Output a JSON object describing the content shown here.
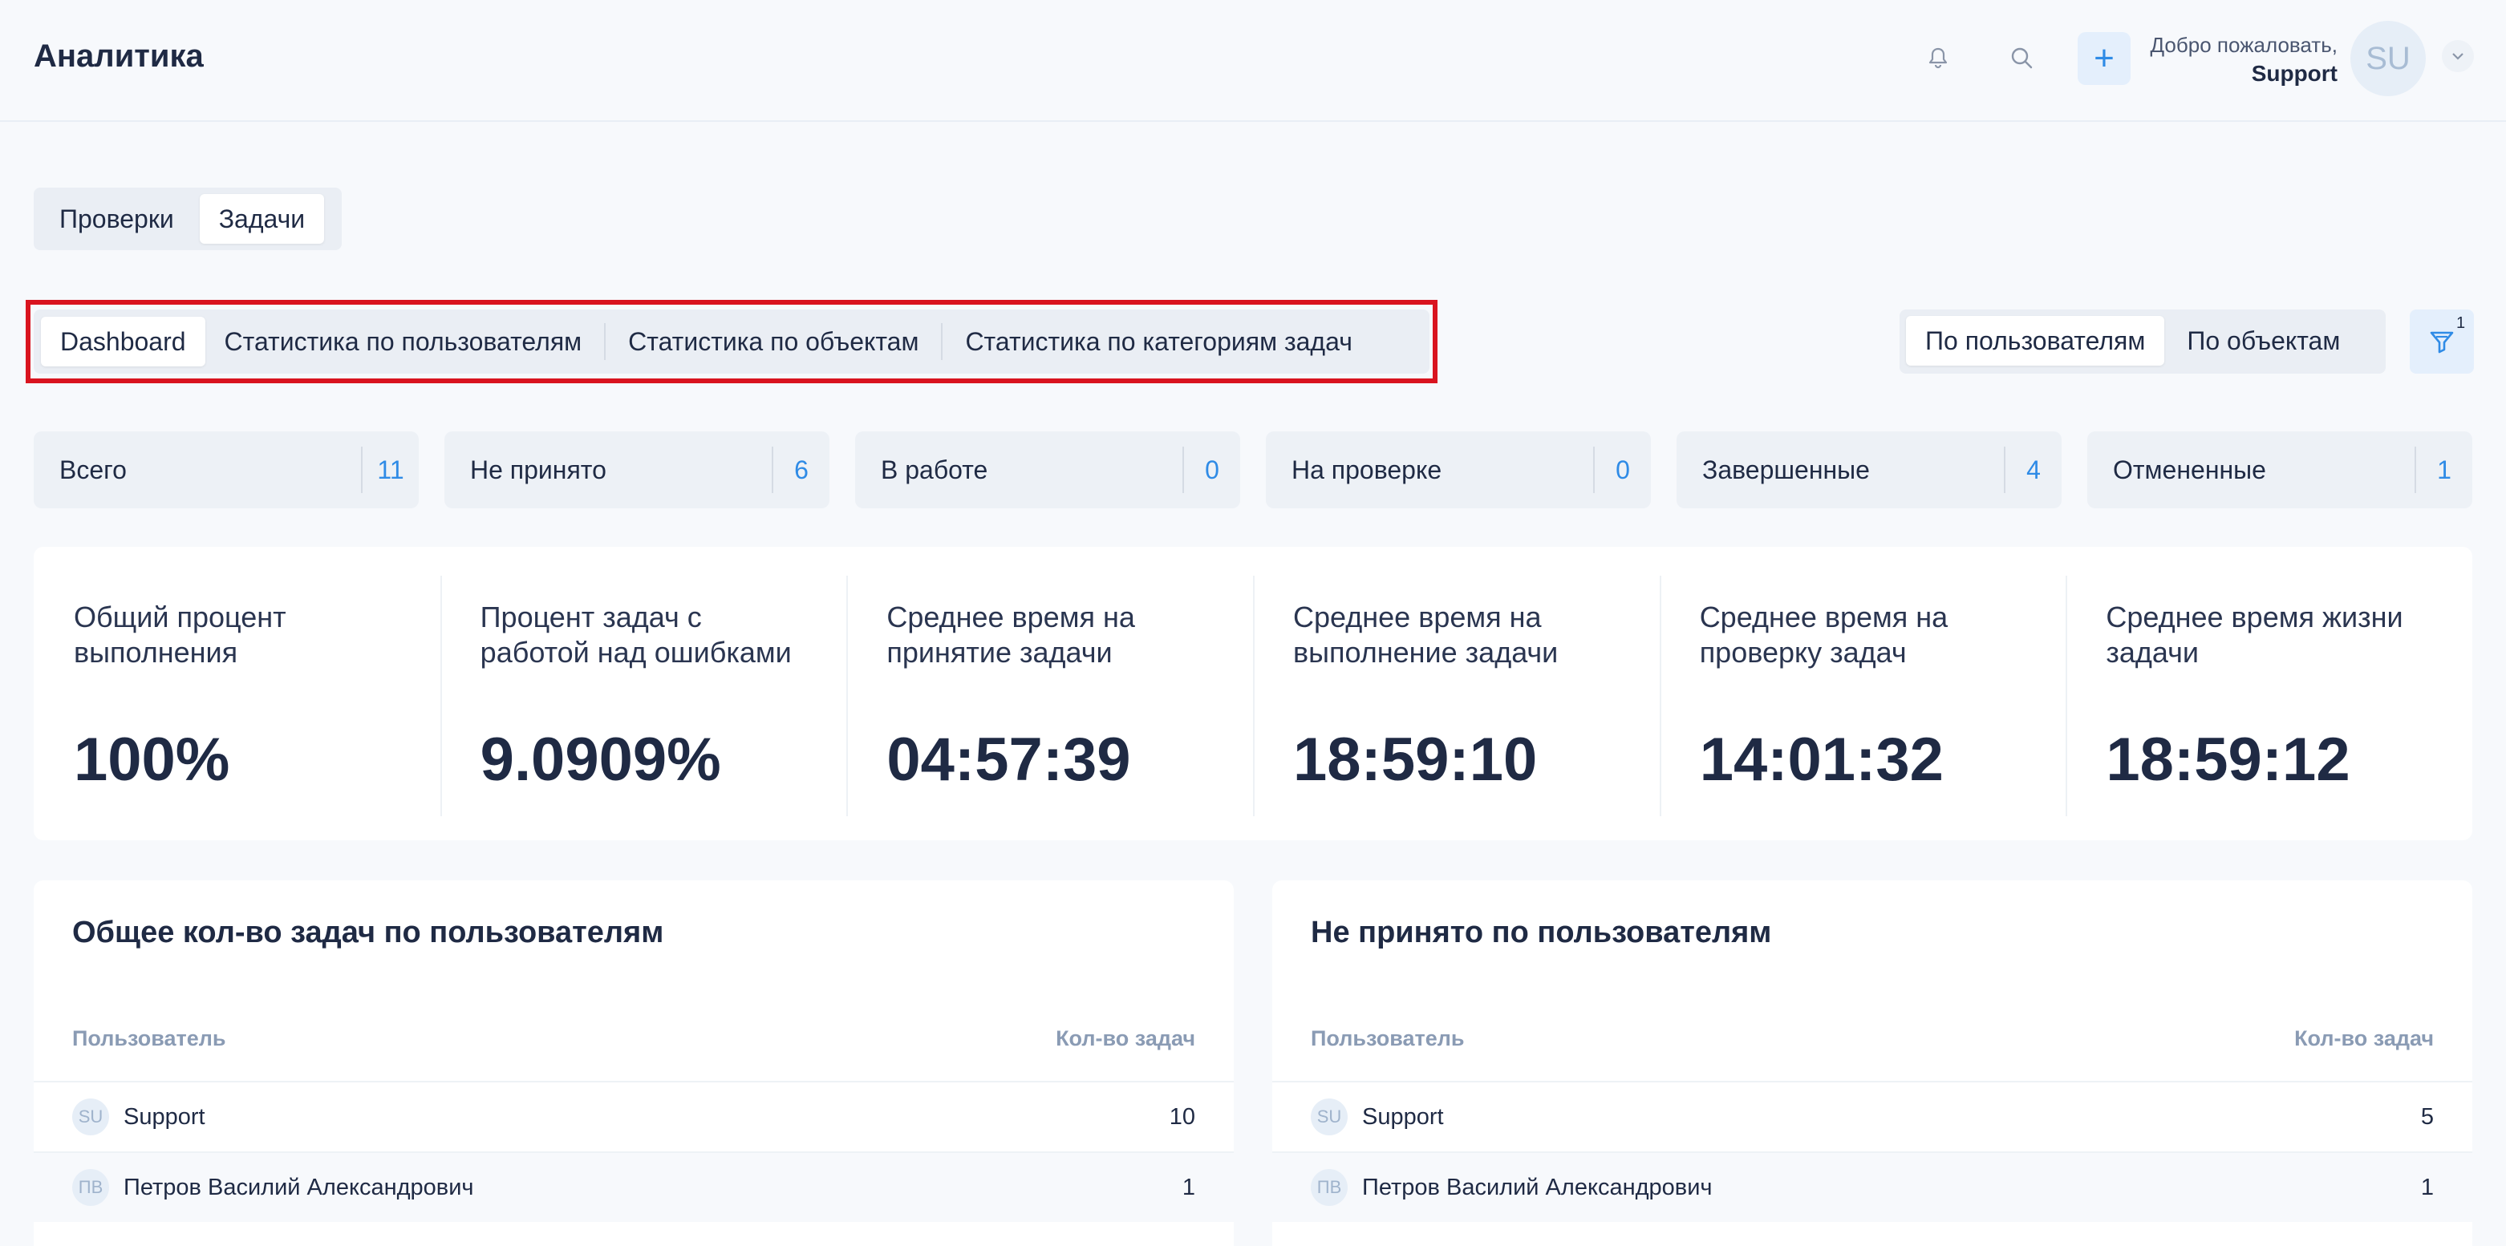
{
  "header": {
    "title": "Аналитика",
    "welcome": "Добро пожаловать,",
    "user_name": "Support",
    "avatar": "SU",
    "plus_label": "+",
    "icons": [
      "bell-icon",
      "search-icon",
      "plus-icon",
      "chevron-down-icon"
    ]
  },
  "top_tabs": [
    {
      "label": "Проверки",
      "active": false
    },
    {
      "label": "Задачи",
      "active": true
    }
  ],
  "sub_tabs": [
    {
      "label": "Dashboard",
      "active": true
    },
    {
      "label": "Статистика по пользователям",
      "active": false
    },
    {
      "label": "Статистика по объектам",
      "active": false
    },
    {
      "label": "Статистика по категориям задач",
      "active": false
    }
  ],
  "view_toggle": [
    {
      "label": "По пользователям",
      "active": true
    },
    {
      "label": "По объектам",
      "active": false
    }
  ],
  "filter": {
    "badge": "1"
  },
  "status_cards": [
    {
      "label": "Всего",
      "value": "11"
    },
    {
      "label": "Не принято",
      "value": "6"
    },
    {
      "label": "В работе",
      "value": "0"
    },
    {
      "label": "На проверке",
      "value": "0"
    },
    {
      "label": "Завершенные",
      "value": "4"
    },
    {
      "label": "Отмененные",
      "value": "1"
    }
  ],
  "metrics": [
    {
      "label": "Общий процент выполнения",
      "value": "100%"
    },
    {
      "label": "Процент задач с работой над ошибками",
      "value": "9.0909%"
    },
    {
      "label": "Среднее время на принятие задачи",
      "value": "04:57:39"
    },
    {
      "label": "Среднее время на выполнение задачи",
      "value": "18:59:10"
    },
    {
      "label": "Среднее время на проверку задач",
      "value": "14:01:32"
    },
    {
      "label": "Среднее время жизни задачи",
      "value": "18:59:12"
    }
  ],
  "tables": [
    {
      "title": "Общее кол-во задач по пользователям",
      "col_user": "Пользователь",
      "col_count": "Кол-во задач",
      "rows": [
        {
          "initials": "SU",
          "name": "Support",
          "count": "10"
        },
        {
          "initials": "ПВ",
          "name": "Петров Василий Александрович",
          "count": "1"
        }
      ]
    },
    {
      "title": "Не принято по пользователям",
      "col_user": "Пользователь",
      "col_count": "Кол-во задач",
      "rows": [
        {
          "initials": "SU",
          "name": "Support",
          "count": "5"
        },
        {
          "initials": "ПВ",
          "name": "Петров Василий Александрович",
          "count": "1"
        }
      ]
    }
  ],
  "colors": {
    "accent": "#2f8be6",
    "highlight_frame": "#d9141f",
    "background": "#f7f9fc"
  }
}
